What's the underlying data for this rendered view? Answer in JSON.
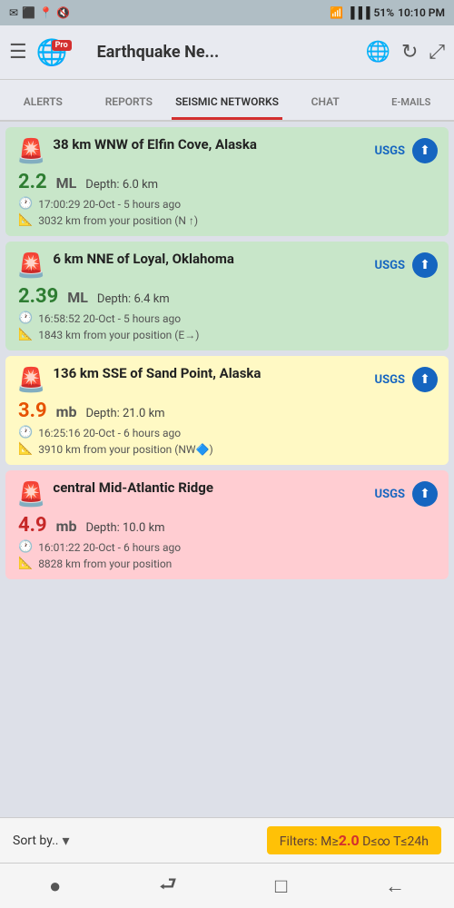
{
  "statusBar": {
    "left": [
      "✉",
      "⬛",
      "📶"
    ],
    "location": "📍",
    "mute": "🔇",
    "wifi": "📶",
    "signal": "▐▐▐▐",
    "battery": "51%",
    "time": "10:10 PM"
  },
  "header": {
    "menuLabel": "☰",
    "globeIcon": "🌐",
    "proBadge": "Pro",
    "title": "Earthquake Ne...",
    "globeAction": "🌐",
    "refreshAction": "↻",
    "expandAction": "⤢"
  },
  "tabs": [
    {
      "id": "alerts",
      "label": "ALERTS",
      "active": false
    },
    {
      "id": "reports",
      "label": "REPORTS",
      "active": false
    },
    {
      "id": "seismic",
      "label": "SEISMIC NETWORKS",
      "active": true
    },
    {
      "id": "chat",
      "label": "CHAT",
      "active": false
    },
    {
      "id": "emails",
      "label": "E-MAILS",
      "active": false
    }
  ],
  "earthquakes": [
    {
      "id": "eq1",
      "icon": "🚨",
      "location": "38 km WNW of Elfin Cove, Alaska",
      "source": "USGS",
      "magnitude": "2.2",
      "magType": "ML",
      "depth": "6.0 km",
      "time": "17:00:29 20-Oct - 5 hours ago",
      "distance": "3032 km from your position (N ↑)",
      "cardColor": "green"
    },
    {
      "id": "eq2",
      "icon": "🚨",
      "location": "6 km NNE of Loyal, Oklahoma",
      "source": "USGS",
      "magnitude": "2.39",
      "magType": "ML",
      "depth": "6.4 km",
      "time": "16:58:52 20-Oct - 5 hours ago",
      "distance": "1843 km from your position (E→)",
      "cardColor": "green"
    },
    {
      "id": "eq3",
      "icon": "🚨",
      "location": "136 km SSE of Sand Point, Alaska",
      "source": "USGS",
      "magnitude": "3.9",
      "magType": "mb",
      "depth": "21.0 km",
      "time": "16:25:16 20-Oct - 6 hours ago",
      "distance": "3910 km from your position (NW🔷)",
      "cardColor": "yellow"
    },
    {
      "id": "eq4",
      "icon": "🚨",
      "location": "central Mid-Atlantic Ridge",
      "source": "USGS",
      "magnitude": "4.9",
      "magType": "mb",
      "depth": "10.0 km",
      "time": "16:01:22 20-Oct - 6 hours ago",
      "distance": "8828 km from your position",
      "cardColor": "red"
    }
  ],
  "bottomBar": {
    "sortLabel": "Sort by..",
    "sortArrow": "▾",
    "filtersLabel": "Filters: M≥",
    "filtersHighlight": "2.0",
    "filtersRest": " D≤∞ T≤24h"
  },
  "navBar": {
    "icons": [
      "●",
      "⮐",
      "□",
      "←"
    ]
  }
}
